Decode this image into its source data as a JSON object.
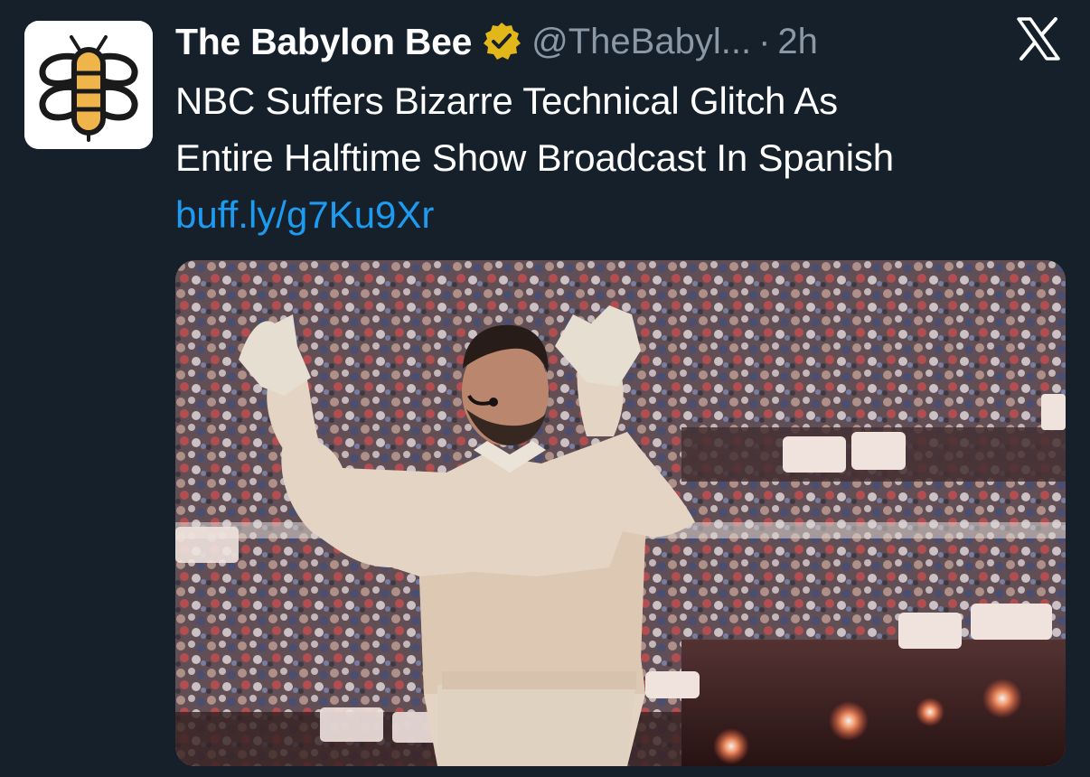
{
  "tweet": {
    "display_name": "The Babylon Bee",
    "handle": "@TheBabyl...",
    "separator": "·",
    "time": "2h",
    "text_lines": [
      "NBC Suffers Bizarre Technical Glitch As",
      "Entire Halftime Show Broadcast In Spanish"
    ],
    "link": "buff.ly/g7Ku9Xr"
  },
  "icons": {
    "avatar": "babylon-bee-logo",
    "verified": "verified-badge-icon",
    "platform": "x-logo-icon"
  },
  "colors": {
    "background": "#15202b",
    "text_primary": "#ffffff",
    "text_secondary": "#8b98a5",
    "link": "#1d9bf0",
    "verified_badge": "#e2b719",
    "bee_yellow": "#f0b54a"
  },
  "media": {
    "type": "photo"
  }
}
